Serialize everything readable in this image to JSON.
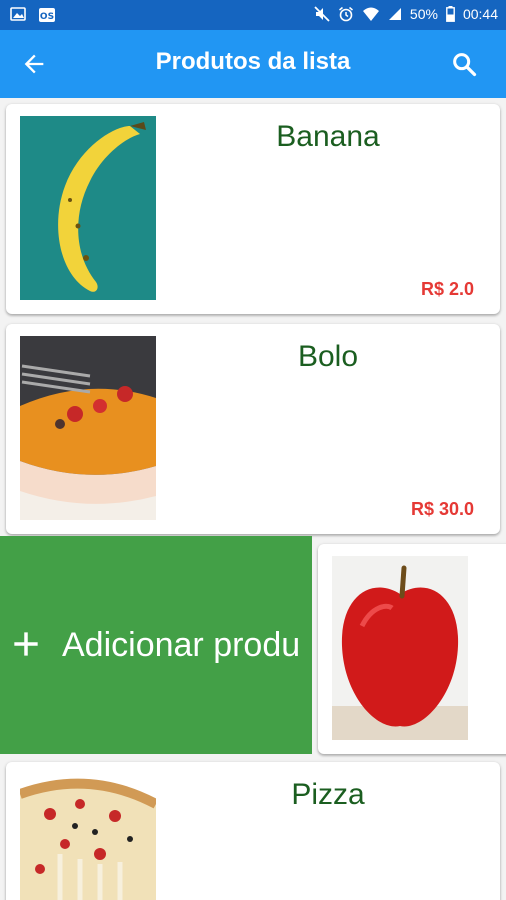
{
  "status_bar": {
    "battery": "50%",
    "time": "00:44"
  },
  "app_bar": {
    "title": "Produtos da lista",
    "back_icon": "arrow-back-icon",
    "search_icon": "search-icon",
    "color": "#2196f3"
  },
  "products": [
    {
      "name": "Banana",
      "price": "R$ 2.0"
    },
    {
      "name": "Bolo",
      "price": "R$ 30.0"
    },
    {
      "name": "",
      "price": ""
    },
    {
      "name": "Pizza",
      "price": ""
    }
  ],
  "swipe_action": {
    "label": "Adicionar produ",
    "icon": "plus-icon",
    "color": "#43a047"
  }
}
